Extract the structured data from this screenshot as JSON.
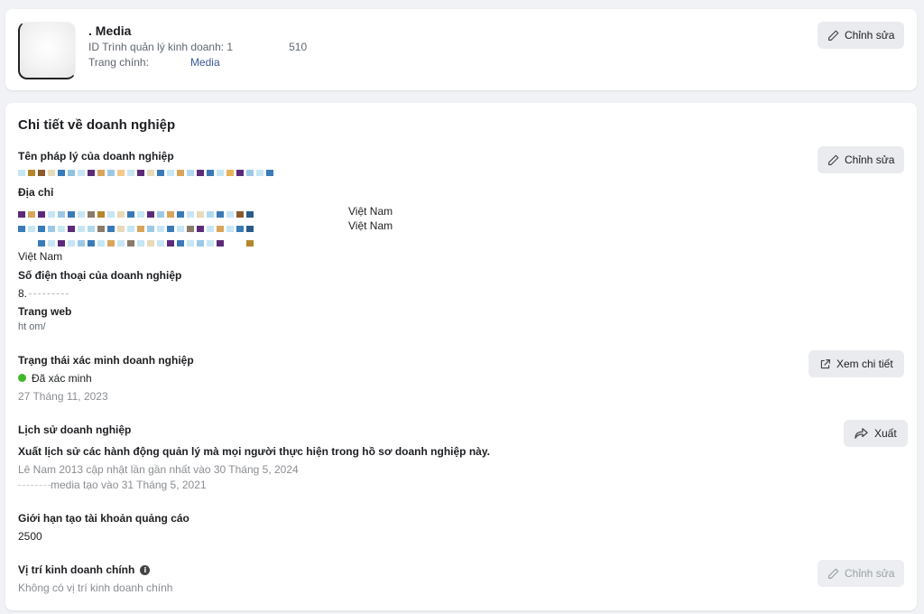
{
  "profile": {
    "name": ". Media",
    "id_label": "ID Trình quản lý kinh doanh: 1",
    "id_suffix": "510",
    "homepage_label": "Trang chính:",
    "homepage_link": "Media",
    "edit_label": "Chỉnh sửa"
  },
  "details": {
    "title": "Chi tiết về doanh nghiệp",
    "legal_name_label": "Tên pháp lý của doanh nghiệp",
    "legal_name_edit": "Chỉnh sửa",
    "address_label": "Địa chỉ",
    "address_country_1": "Việt Nam",
    "address_country_2": "Việt Nam",
    "address_country_3": "Việt Nam",
    "phone_label": "Số điện thoại của doanh nghiệp",
    "phone_value": "8.",
    "website_label": "Trang web",
    "website_value": "ht                    om/",
    "verification_label": "Trạng thái xác minh doanh nghiệp",
    "verification_status": "Đã xác minh",
    "verification_date": "27 Tháng 11, 2023",
    "view_details": "Xem chi tiết",
    "history_label": "Lịch sử doanh nghiệp",
    "history_desc": "Xuất lịch sử các hành động quản lý mà mọi người thực hiện trong hồ sơ doanh nghiệp này.",
    "history_updated": "Lê Nam 2013 cập nhật lần gần nhất vào 30 Tháng 5, 2024",
    "history_created": "media tạo vào 31 Tháng 5, 2021",
    "export_label": "Xuất",
    "ad_limit_label": "Giới hạn tạo tài khoản quảng cáo",
    "ad_limit_value": "2500",
    "location_label": "Vị trí kinh doanh chính",
    "location_value": "Không có vị trí kinh doanh chính",
    "location_edit": "Chỉnh sửa"
  },
  "colors": {
    "verified": "#42b72a",
    "link": "#385898",
    "button_bg": "#e9ebee"
  }
}
